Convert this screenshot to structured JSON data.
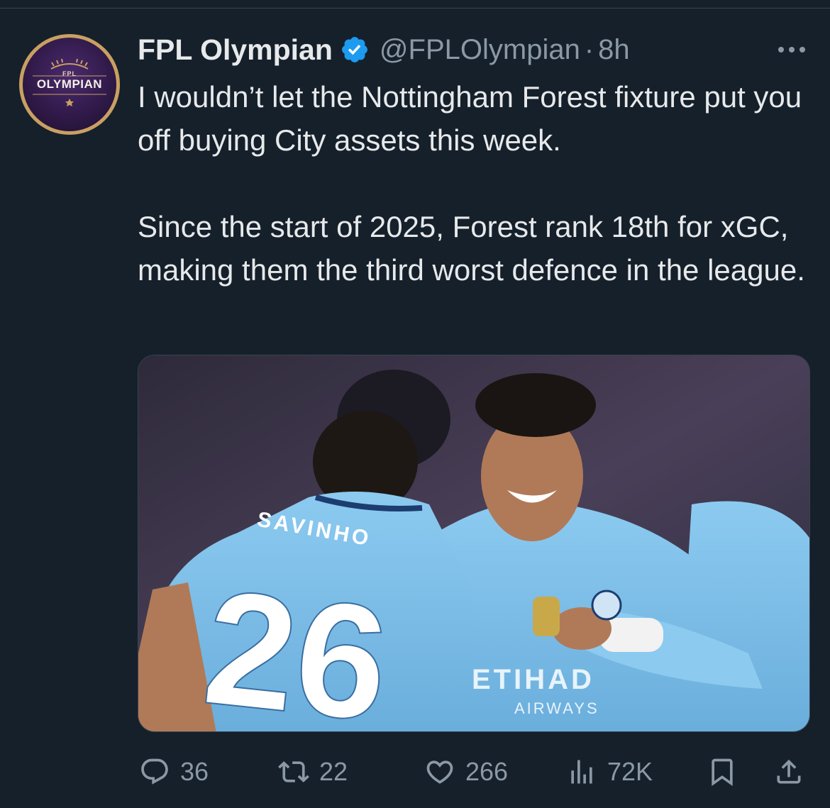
{
  "author": {
    "display_name": "FPL Olympian",
    "handle": "@FPLOlympian",
    "separator": "·",
    "time": "8h",
    "avatar_small_text": "FPL",
    "avatar_text": "OLYMPIAN"
  },
  "tweet": {
    "paragraph_1": "I wouldn’t let the Nottingham Forest fixture put you off buying City assets this week.",
    "paragraph_2": "Since the start of 2025, Forest rank 18th for xGC, making them the third worst defence in the league."
  },
  "media": {
    "jersey_name": "SAVINHO",
    "jersey_number": "26",
    "sponsor": "ETIHAD",
    "sponsor_sub": "AIRWAYS"
  },
  "actions": {
    "replies": "36",
    "retweets": "22",
    "likes": "266",
    "views": "72K"
  },
  "icons": {
    "verified": "verified-badge-icon",
    "more": "more-icon",
    "reply": "reply-icon",
    "retweet": "retweet-icon",
    "like": "heart-icon",
    "views": "views-icon",
    "bookmark": "bookmark-icon",
    "share": "share-icon"
  },
  "colors": {
    "background": "#15202b",
    "text": "#e7e9ea",
    "muted": "#8b98a5",
    "verified": "#1d9bf0",
    "city_blue": "#7fbfe8"
  }
}
